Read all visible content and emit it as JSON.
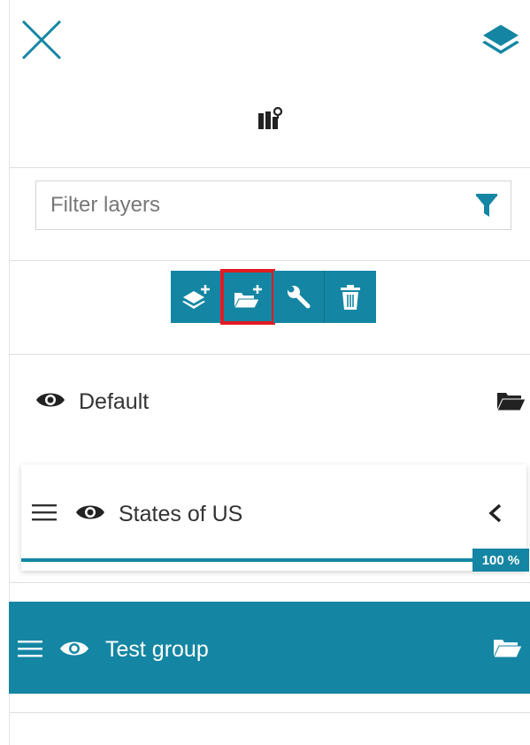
{
  "filter": {
    "placeholder": "Filter layers"
  },
  "layers": {
    "default": {
      "label": "Default"
    },
    "states": {
      "label": "States of US",
      "progress_label": "100 %",
      "progress": 1.0
    },
    "test_group": {
      "label": "Test group"
    }
  },
  "colors": {
    "accent": "#1486a3",
    "highlight": "#e21b23",
    "text": "#333333"
  },
  "icons": [
    "close-icon",
    "layers-icon",
    "map-legend-icon",
    "filter-icon",
    "add-layer-icon",
    "add-group-icon",
    "wrench-icon",
    "trash-icon",
    "eye-icon",
    "folder-icon",
    "drag-handle-icon",
    "chevron-left-icon"
  ]
}
